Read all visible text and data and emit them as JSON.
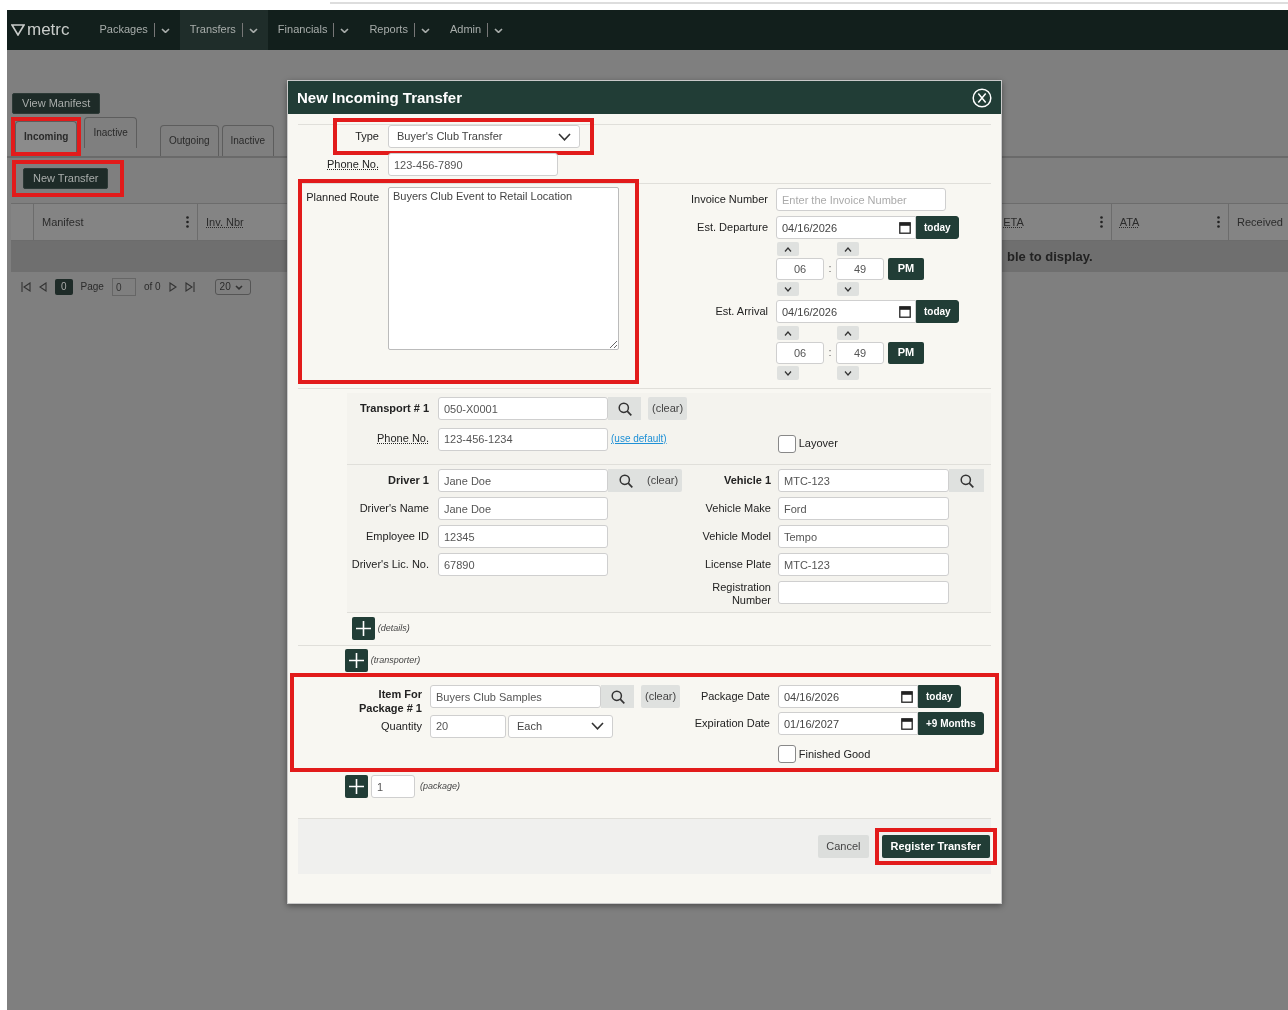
{
  "nav": {
    "logo": "metrc",
    "menus": [
      {
        "label": "Packages",
        "selected": false
      },
      {
        "label": "Transfers",
        "selected": true
      },
      {
        "label": "Financials",
        "selected": false
      },
      {
        "label": "Reports",
        "selected": false
      },
      {
        "label": "Admin",
        "selected": false
      }
    ]
  },
  "page": {
    "view_manifest": "View Manifest",
    "tab_groups": [
      [
        {
          "label": "Incoming",
          "selected": true,
          "highlighted": true
        },
        {
          "label": "Inactive",
          "selected": false,
          "highlighted": false
        }
      ],
      [
        {
          "label": "Outgoing",
          "selected": false,
          "highlighted": false
        },
        {
          "label": "Inactive",
          "selected": false,
          "highlighted": false
        }
      ]
    ],
    "new_transfer": {
      "label": "New Transfer",
      "highlighted": true
    },
    "table": {
      "columns": [
        "Manifest",
        "Inv. Nbr",
        "ETA",
        "ATA",
        "Received"
      ],
      "empty_message": "ble to display."
    },
    "pager": {
      "current": "0",
      "page_label": "Page",
      "page_value": "0",
      "of": "of 0",
      "page_size": "20"
    }
  },
  "modal": {
    "title": "New Incoming Transfer",
    "type": {
      "label": "Type",
      "value": "Buyer's Club Transfer",
      "highlighted": true
    },
    "phone": {
      "label": "Phone No.",
      "value": "123-456-7890"
    },
    "planned_route": {
      "label": "Planned Route",
      "value": "Buyers Club Event to Retail Location",
      "highlighted": true
    },
    "invoice": {
      "label": "Invoice Number",
      "placeholder": "Enter the Invoice Number"
    },
    "schedule": [
      {
        "label": "Est. Departure",
        "date": "04/16/2026",
        "button": "today",
        "hour": "06",
        "separator": ":",
        "minute": "49",
        "ampm": "PM"
      },
      {
        "label": "Est. Arrival",
        "date": "04/16/2026",
        "button": "today",
        "hour": "06",
        "separator": ":",
        "minute": "49",
        "ampm": "PM"
      }
    ],
    "transport": {
      "label": "Transport # 1",
      "value": "050-X0001",
      "clear": "(clear)",
      "phone_label": "Phone No.",
      "phone_value": "123-456-1234",
      "use_default": "(use default)",
      "layover": {
        "label": "Layover",
        "checked": false
      }
    },
    "driver_fields": [
      {
        "kind": "lookup",
        "label": "Driver 1",
        "value": "Jane Doe",
        "clear": "(clear)"
      },
      {
        "kind": "text",
        "label": "Driver's Name",
        "value": "Jane Doe"
      },
      {
        "kind": "text",
        "label": "Employee ID",
        "value": "12345"
      },
      {
        "kind": "text",
        "label": "Driver's Lic. No.",
        "value": "67890"
      }
    ],
    "vehicle_fields": [
      {
        "kind": "lookup",
        "label": "Vehicle 1",
        "value": "MTC-123"
      },
      {
        "kind": "text",
        "label": "Vehicle Make",
        "value": "Ford"
      },
      {
        "kind": "text",
        "label": "Vehicle Model",
        "value": "Tempo"
      },
      {
        "kind": "text",
        "label": "License Plate",
        "value": "MTC-123"
      },
      {
        "kind": "text",
        "label": "Registration Number"
      }
    ],
    "details_add": "(details)",
    "transporter_add": "(transporter)",
    "package": {
      "highlighted": true,
      "item_label": "Item For Package # 1",
      "item_value": "Buyers Club Samples",
      "clear": "(clear)",
      "quantity_label": "Quantity",
      "quantity": "20",
      "unit": "Each",
      "package_date_label": "Package Date",
      "package_date": "04/16/2026",
      "today": "today",
      "expiration_label": "Expiration Date",
      "expiration": "01/16/2027",
      "plus_months": "+9 Months",
      "finished_good": {
        "label": "Finished Good",
        "checked": false
      }
    },
    "package_add": {
      "count": "1",
      "label": "(package)"
    },
    "cancel": "Cancel",
    "register": {
      "label": "Register Transfer",
      "highlighted": true
    }
  }
}
